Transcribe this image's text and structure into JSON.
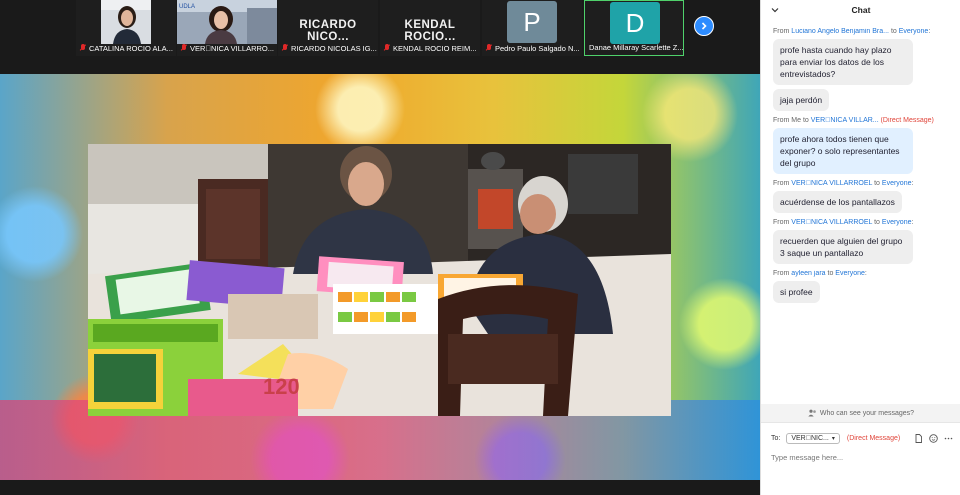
{
  "participants": [
    {
      "name": "CATALINA ROCIO ALA...",
      "type": "video",
      "muted": true
    },
    {
      "name": "VER\u0000NICA VILLARRO...",
      "type": "video",
      "muted": true,
      "active": true
    },
    {
      "name": "RICARDO NICOLAS IG...",
      "type": "name",
      "big_label": "RICARDO  NICO...",
      "muted": true
    },
    {
      "name": "KENDAL ROCIO REIM...",
      "type": "name",
      "big_label": "KENDAL  ROCIO...",
      "muted": true
    },
    {
      "name": "Pedro Paulo Salgado N...",
      "type": "initial",
      "initial": "P",
      "color": "#6f8a99",
      "muted": true
    },
    {
      "name": "Danae Millaray Scarlette Z...",
      "type": "initial",
      "initial": "D",
      "color": "#1fa3a8",
      "muted": false,
      "active": true
    }
  ],
  "chat": {
    "title": "Chat",
    "messages": [
      {
        "from": "From",
        "sender": "Luciano Angelo Benjamin Bra...",
        "to_word": "to",
        "recipient": "Everyone",
        "direct": "",
        "text": "profe hasta cuando hay plazo para enviar los datos de los entrevistados?",
        "me": false
      },
      {
        "from": "",
        "sender": "",
        "to_word": "",
        "recipient": "",
        "direct": "",
        "text": "jaja perdón",
        "me": false,
        "continued": true
      },
      {
        "from": "From Me",
        "sender": "",
        "to_word": "to",
        "recipient": "VER\u0000NICA VILLAR...",
        "direct": "(Direct Message)",
        "text": "profe ahora todos tienen que exponer? o solo representantes del grupo",
        "me": true
      },
      {
        "from": "From",
        "sender": "VER\u0000NICA VILLARROEL",
        "to_word": "to",
        "recipient": "Everyone",
        "direct": "",
        "text": "acuérdense de los pantallazos",
        "me": false
      },
      {
        "from": "From",
        "sender": "VER\u0000NICA VILLARROEL",
        "to_word": "to",
        "recipient": "Everyone",
        "direct": "",
        "text": "recuerden que alguien del grupo 3 saque un pantallazo",
        "me": false
      },
      {
        "from": "From",
        "sender": "ayleen jara",
        "to_word": "to",
        "recipient": "Everyone",
        "direct": "",
        "text": "si profee",
        "me": false
      }
    ],
    "privacy_note": "Who can see your messages?",
    "to_label": "To:",
    "to_value": "VER\u0000NIC...",
    "to_direct": "(Direct Message)",
    "placeholder": "Type message here..."
  },
  "colors": {
    "accent": "#2d8cff",
    "muted_mic": "#e02828",
    "link": "#1f74d6",
    "direct": "#e0453a"
  }
}
